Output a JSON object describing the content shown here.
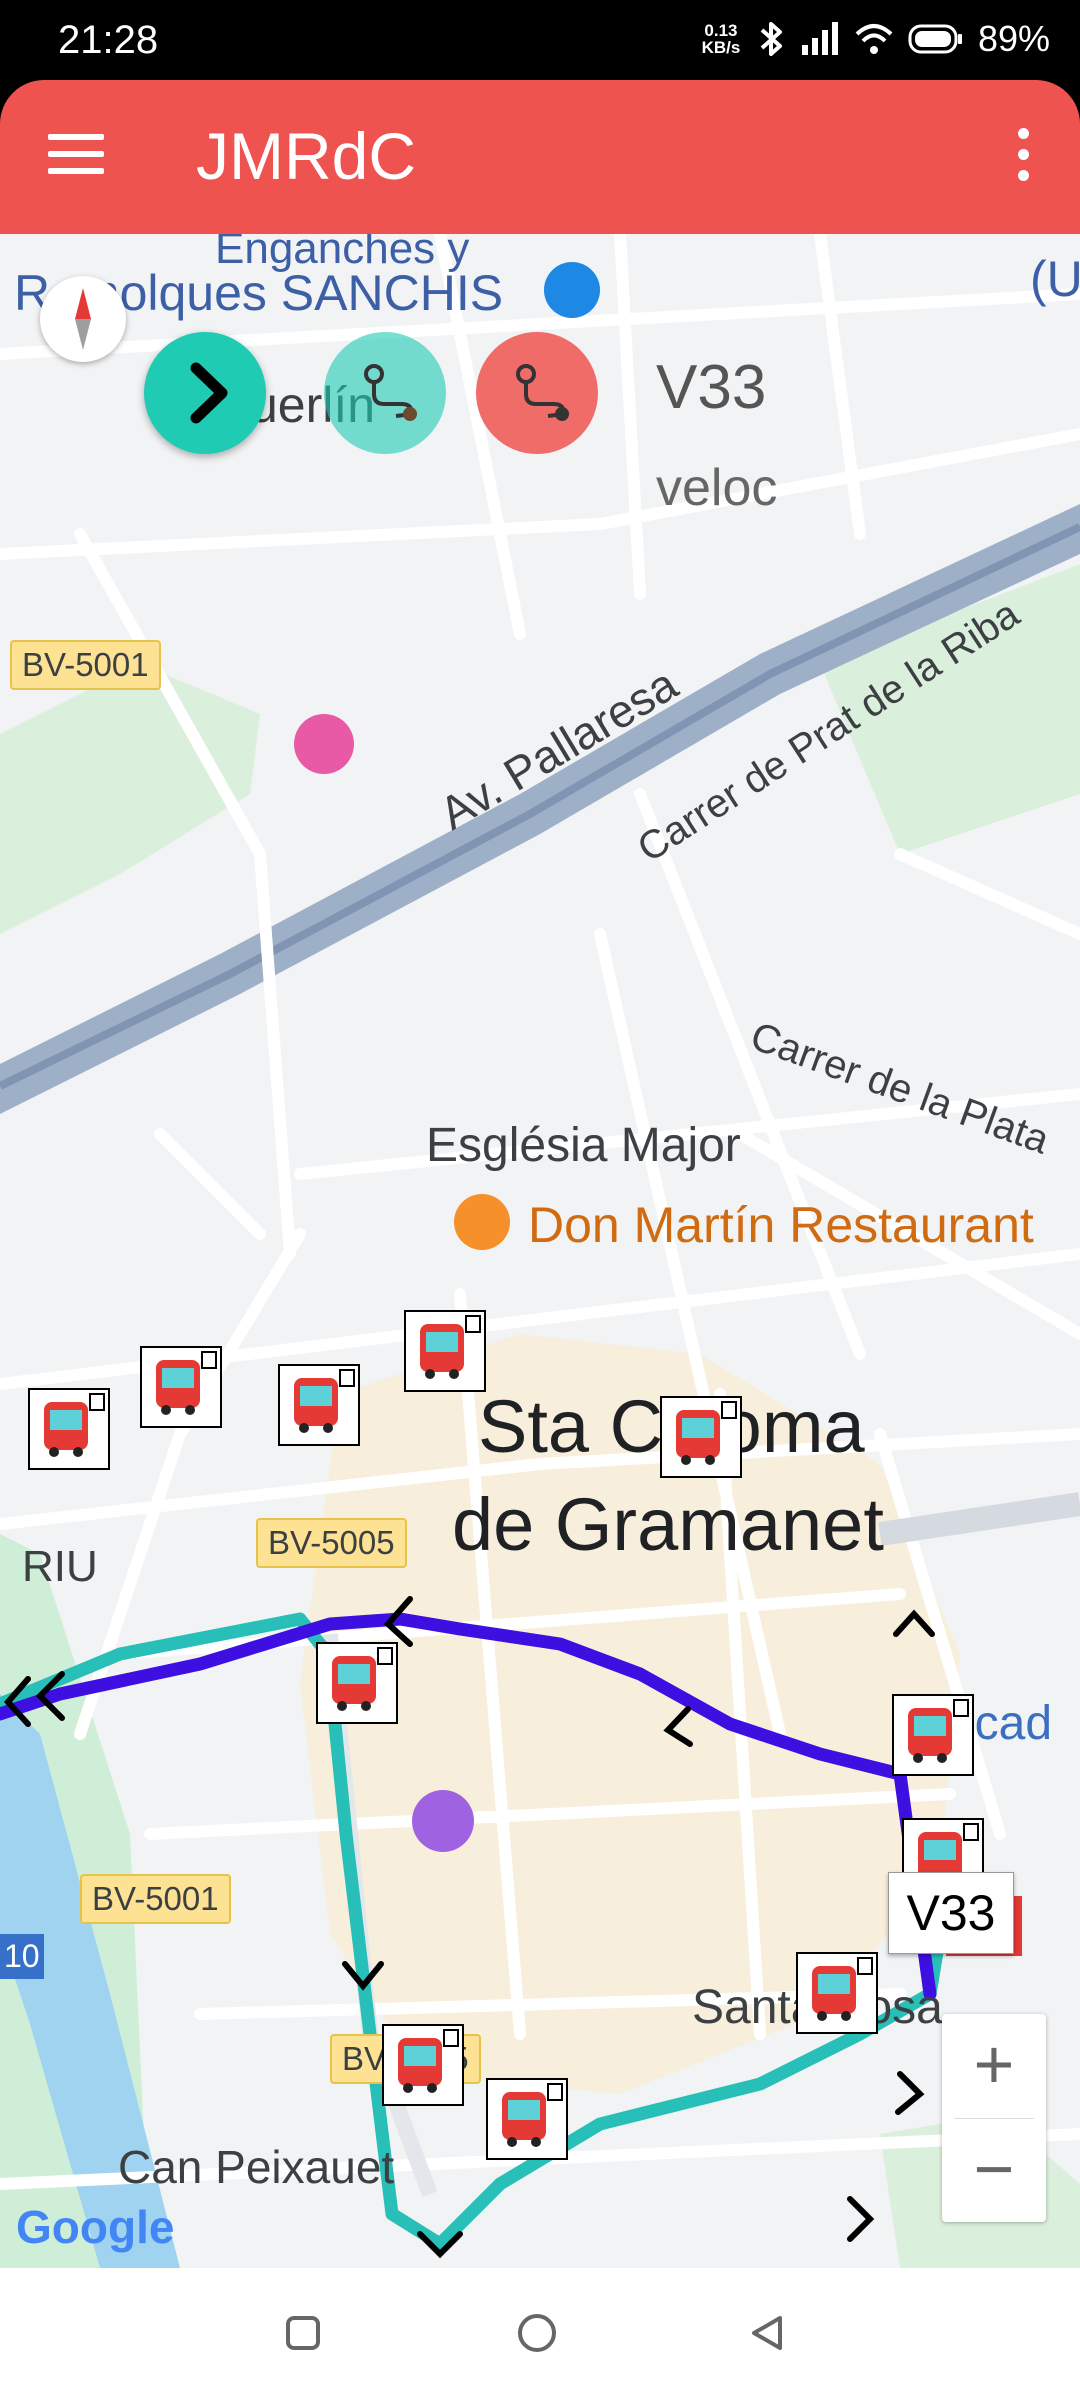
{
  "status_bar": {
    "time": "21:28",
    "net_speed_value": "0.13",
    "net_speed_unit": "KB/s",
    "battery": "89%",
    "icons": [
      "bluetooth-icon",
      "signal-icon",
      "wifi-icon",
      "battery-icon"
    ]
  },
  "app_bar": {
    "title": "JMRdC",
    "background": "#ef5350",
    "menu_icon": "hamburger-icon",
    "overflow_icon": "more-vert-icon"
  },
  "controls": {
    "route_code": "V33",
    "speed_label": "veloc",
    "next_icon": "chevron-right-icon",
    "route_icon_1": "route-icon",
    "route_icon_2": "route-icon",
    "next_color": "#1fcbb2",
    "route2_color": "#ef5350"
  },
  "map": {
    "labels": {
      "poi_top_line1": "Enganches y",
      "poi_top_line2": "Remolques SANCHIS",
      "poi_top_right": "(U",
      "poi_merlin": "uerlín",
      "road_bv5001_top": "BV-5001",
      "street_pallaresa": "Av. Pallaresa",
      "street_prat": "Carrer de Prat de la Riba",
      "street_plata": "Carrer de la Plata",
      "poi_esglesia": "Església Major",
      "poi_restaurant": "Don Martín Restaurant",
      "town_line1": "Sta Coloma",
      "town_line2": "de Gramanet",
      "area_riu": "RIU",
      "road_bv5005_mid": "BV-5005",
      "poi_mercat": "Mercad",
      "road_bv5001_bottom": "BV-5001",
      "road_10": "10",
      "poi_santa_rosa": "Santa Rosa",
      "road_bv5005_bottom": "BV-5005",
      "poi_can_peixauet": "Can Peixauet"
    },
    "info_window": "V33",
    "zoom_in": "+",
    "zoom_out": "−",
    "attribution": "Google",
    "route_colors": {
      "outbound": "#3d0fe0",
      "return": "#27bfb7"
    },
    "bus_stop_icon": "bus-stop-icon"
  },
  "nav_bar": {
    "recents_icon": "recents-square-icon",
    "home_icon": "home-circle-icon",
    "back_icon": "back-triangle-icon"
  }
}
